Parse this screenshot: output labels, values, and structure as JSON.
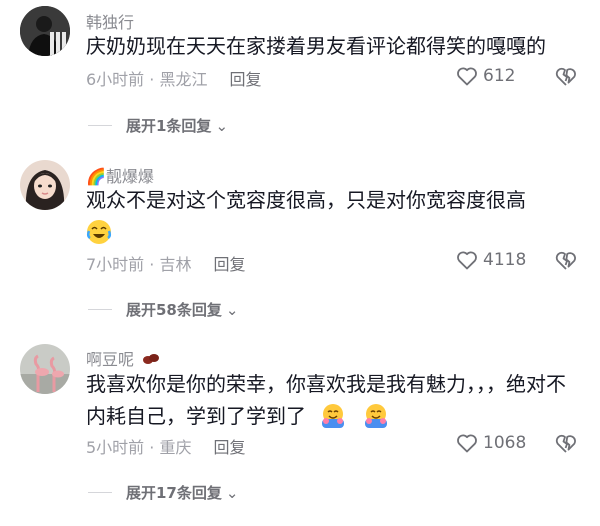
{
  "comments": [
    {
      "avatar_icon": "avatar-silhouette",
      "username": "韩独行",
      "content": "庆奶奶现在天天在家搂着男友看评论都得笑的嘎嘎的",
      "time_location": "6小时前 · 黑龙江",
      "reply_label": "回复",
      "likes": "612",
      "expand_label": "展开1条回复"
    },
    {
      "avatar_icon": "avatar-girl",
      "username_emoji": "🌈",
      "username": "靓爆爆",
      "content": "观众不是对这个宽容度很高，只是对你宽容度很高",
      "sticker": "crying-laughing-face",
      "time_location": "7小时前 · 吉林",
      "reply_label": "回复",
      "likes": "4118",
      "expand_label": "展开58条回复"
    },
    {
      "avatar_icon": "avatar-flamingo",
      "username": "啊豆呢",
      "username_emoji": "bean",
      "content": "我喜欢你是你的荣幸，你喜欢我是我有魅力，，，绝对不内耗自己，学到了学到了",
      "sticker": "hugging-face",
      "time_location": "5小时前 · 重庆",
      "reply_label": "回复",
      "likes": "1068",
      "expand_label": "展开17条回复"
    }
  ],
  "colors": {
    "meta": "#a0a1a8",
    "text": "#161823",
    "accent": "#6f7076"
  }
}
